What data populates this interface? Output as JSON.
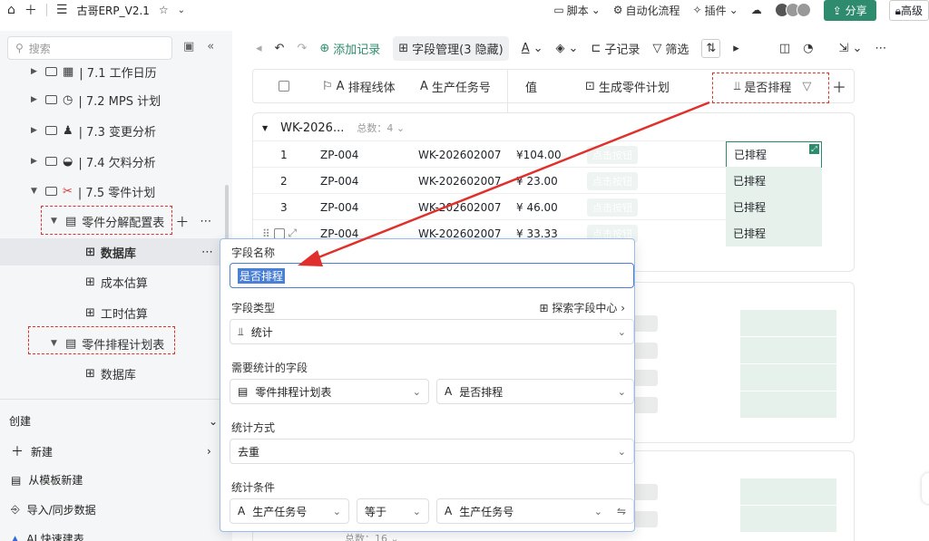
{
  "topbar": {
    "title": "古哥ERP_V2.1",
    "script_label": "脚本",
    "automation_label": "自动化流程",
    "plugin_label": "插件",
    "share_label": "分享",
    "advanced_label": "高级"
  },
  "sidebar": {
    "search_placeholder": "搜索",
    "items": [
      {
        "label": "| 7.1 工作日历"
      },
      {
        "label": "| 7.2 MPS 计划"
      },
      {
        "label": "| 7.3 变更分析"
      },
      {
        "label": "| 7.4 欠料分析"
      },
      {
        "label": "| 7.5 零件计划"
      },
      {
        "label": "零件分解配置表"
      },
      {
        "label": "数据库"
      },
      {
        "label": "成本估算"
      },
      {
        "label": "工时估算"
      },
      {
        "label": "零件排程计划表"
      },
      {
        "label": "数据库"
      }
    ],
    "bottom": {
      "create_header": "创建",
      "new_label": "新建",
      "from_template": "从模板新建",
      "import_sync": "导入/同步数据",
      "ai_build": "AI 快速建表"
    }
  },
  "toolbar": {
    "add_record": "添加记录",
    "field_manage": "字段管理(3 隐藏)",
    "sub_record": "子记录",
    "filter": "筛选"
  },
  "grid": {
    "columns": [
      "排程线体",
      "生产任务号",
      "值",
      "生成零件计划",
      "是否排程"
    ],
    "group": {
      "name": "WK-2026...",
      "count_label": "总数：4"
    },
    "rows": [
      {
        "num": "1",
        "line": "ZP-004",
        "task": "WK-202602007",
        "value": "¥104.00",
        "btn": "点击按钮",
        "status": "已排程"
      },
      {
        "num": "2",
        "line": "ZP-004",
        "task": "WK-202602007",
        "value": "¥ 23.00",
        "btn": "点击按钮",
        "status": "已排程"
      },
      {
        "num": "3",
        "line": "ZP-004",
        "task": "WK-202602007",
        "value": "¥ 46.00",
        "btn": "点击按钮",
        "status": "已排程"
      },
      {
        "num": "",
        "line": "ZP-004",
        "task": "WK-202602007",
        "value": "¥ 33.33",
        "btn": "点击按钮",
        "status": "已排程"
      }
    ],
    "footer_count": "总数：16"
  },
  "popup": {
    "field_name_label": "字段名称",
    "field_name_value": "是否排程",
    "field_type_label": "字段类型",
    "explore_label": "探索字段中心",
    "field_type_value": "统计",
    "stat_field_label": "需要统计的字段",
    "stat_table": "零件排程计划表",
    "stat_field": "是否排程",
    "method_label": "统计方式",
    "method_value": "去重",
    "condition_label": "统计条件",
    "cond_field": "生产任务号",
    "cond_op": "等于",
    "cond_value": "生产任务号"
  },
  "colors": {
    "accent": "#2e8b6e",
    "annotation": "#e0302b",
    "focus": "#4a7fd6"
  }
}
